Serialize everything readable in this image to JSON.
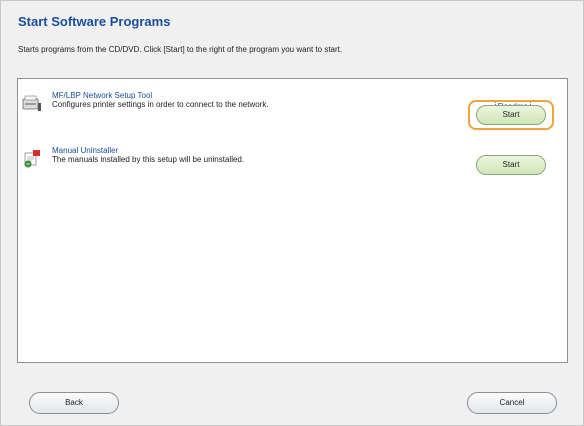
{
  "header": {
    "title": "Start Software Programs",
    "instruction": "Starts programs from the CD/DVD. Click [Start] to the right of the program you want to start."
  },
  "programs": [
    {
      "name": "MF/LBP Network Setup Tool",
      "description": "Configures printer settings in order to connect to the network.",
      "readme_label": "Readme",
      "start_label": "Start",
      "icon": "printer-network-icon"
    },
    {
      "name": "Manual Uninstaller",
      "description": "The manuals installed by this setup will be uninstalled.",
      "start_label": "Start",
      "icon": "manual-uninstaller-icon"
    }
  ],
  "footer": {
    "back_label": "Back",
    "cancel_label": "Cancel"
  },
  "colors": {
    "title": "#1a4f9c",
    "focus_ring": "#f2a33a",
    "start_button": "#cfe6b7"
  }
}
